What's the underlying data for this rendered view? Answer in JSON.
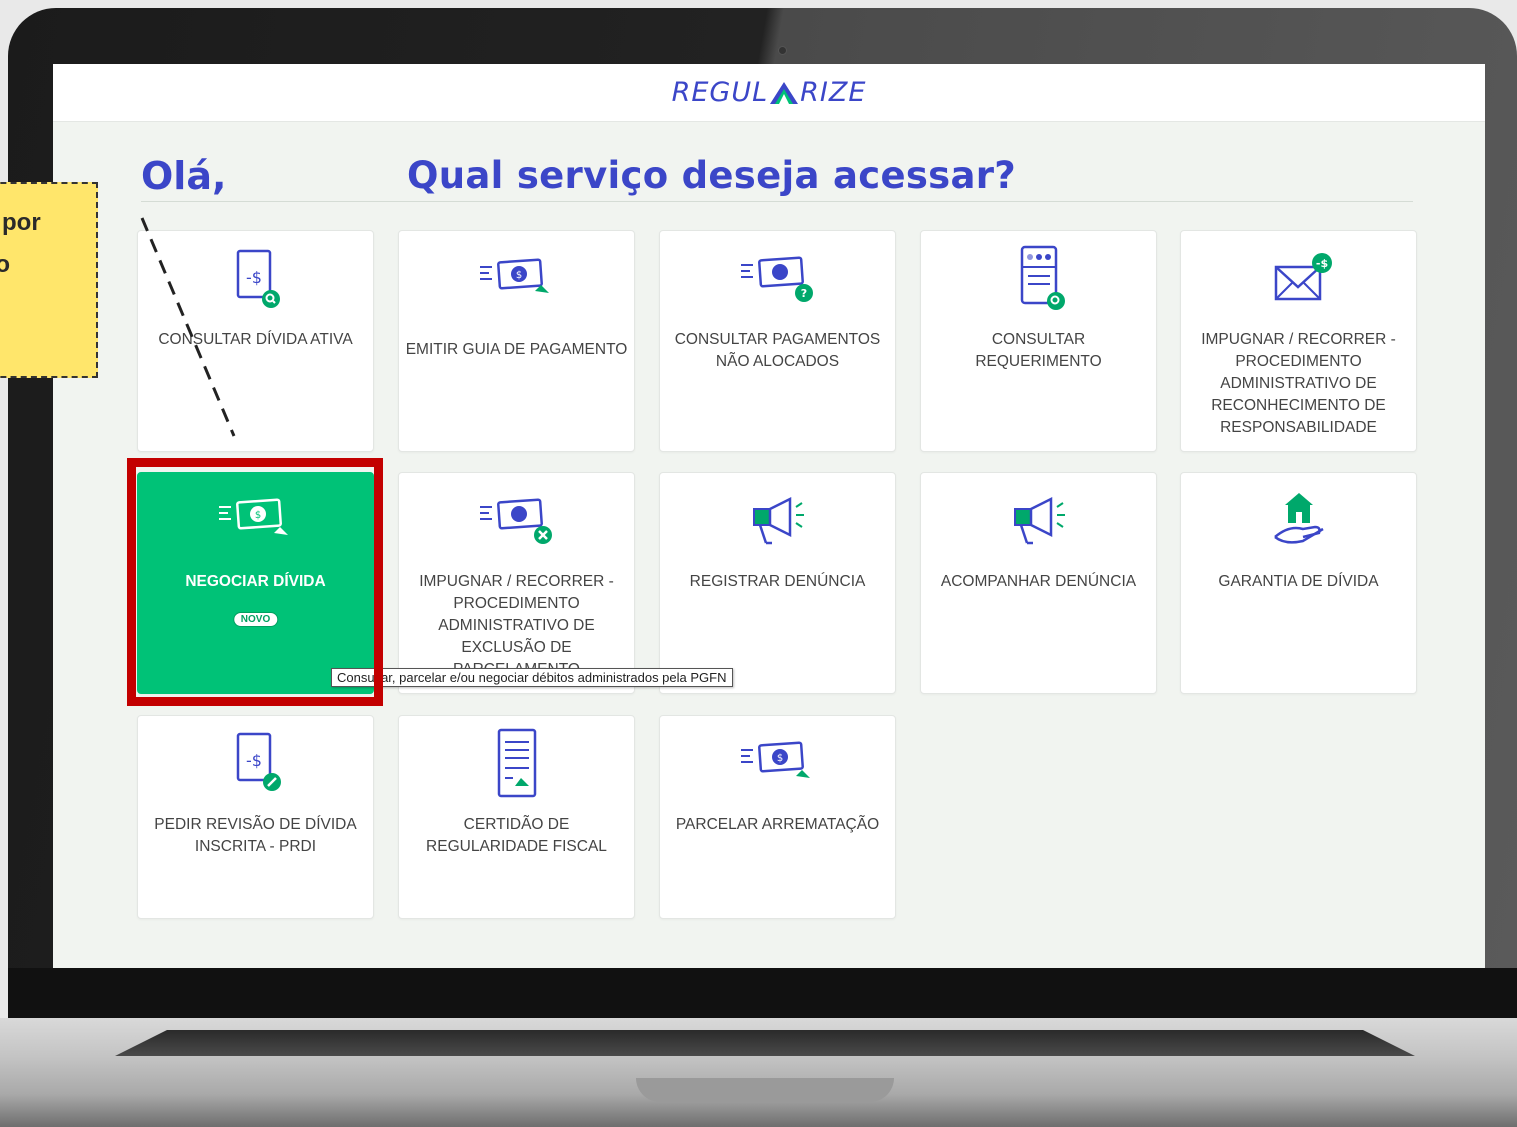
{
  "logo": {
    "part1": "REGUL",
    "part2": "RIZE"
  },
  "header": {
    "hello": "Olá,",
    "question": "Qual serviço deseja acessar?"
  },
  "cards": [
    {
      "label": "CONSULTAR DÍVIDA ATIVA",
      "icon": "dollar-doc-search-icon"
    },
    {
      "label": "EMITIR GUIA DE PAGAMENTO",
      "icon": "money-bills-check-icon"
    },
    {
      "label": "CONSULTAR PAGAMENTOS NÃO ALOCADOS",
      "icon": "money-bill-question-icon"
    },
    {
      "label": "CONSULTAR REQUERIMENTO",
      "icon": "document-search-icon"
    },
    {
      "label": "IMPUGNAR / RECORRER - PROCEDIMENTO ADMINISTRATIVO DE RECONHECIMENTO DE RESPONSABILIDADE",
      "icon": "envelope-money-icon"
    },
    {
      "label": "NEGOCIAR DÍVIDA",
      "badge": "NOVO",
      "icon": "money-bills-check-icon"
    },
    {
      "label": "IMPUGNAR / RECORRER - PROCEDIMENTO ADMINISTRATIVO DE EXCLUSÃO DE PARCELAMENTO",
      "icon": "money-bill-remove-icon"
    },
    {
      "label": "REGISTRAR DENÚNCIA",
      "icon": "megaphone-icon"
    },
    {
      "label": "ACOMPANHAR DENÚNCIA",
      "icon": "megaphone-icon"
    },
    {
      "label": "GARANTIA DE DÍVIDA",
      "icon": "hand-house-icon"
    },
    {
      "label": "PEDIR REVISÃO DE DÍVIDA INSCRITA - PRDI",
      "icon": "dollar-doc-edit-icon"
    },
    {
      "label": "CERTIDÃO DE REGULARIDADE FISCAL",
      "icon": "certificate-doc-icon"
    },
    {
      "label": "PARCELAR ARREMATAÇÃO",
      "icon": "money-bills-check-icon"
    }
  ],
  "tooltip": "Consultar, parcelar e/ou negociar débitos administrados pela PGFN",
  "note": {
    "line1": "é por",
    "line2": ", o"
  },
  "colors": {
    "primary": "#3b46c8",
    "accent": "#00c277",
    "highlight": "#c30000",
    "note": "#ffe66b"
  }
}
